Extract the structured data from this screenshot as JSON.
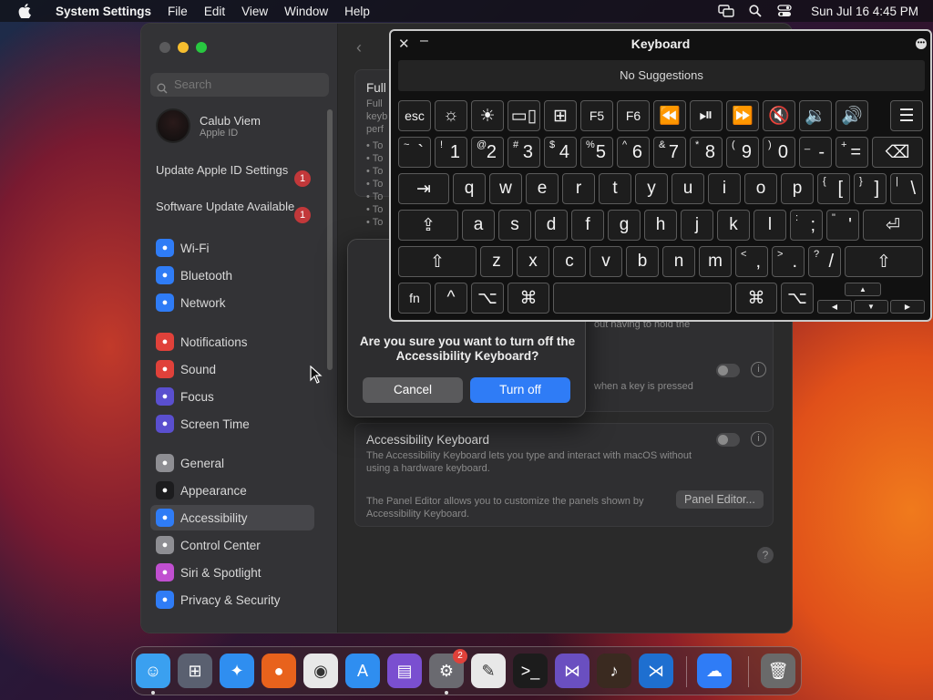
{
  "menubar": {
    "app_name": "System Settings",
    "menus": [
      "File",
      "Edit",
      "View",
      "Window",
      "Help"
    ],
    "status_icons": [
      "screen-mirroring-icon",
      "spotlight-search-icon",
      "control-center-icon"
    ],
    "datetime": "Sun Jul 16  4:45 PM"
  },
  "settings_window": {
    "search_placeholder": "Search",
    "profile": {
      "name": "Calub Viem",
      "subtitle": "Apple ID"
    },
    "notices": [
      {
        "label": "Update Apple ID Settings",
        "badge": "1"
      },
      {
        "label": "Software Update Available",
        "badge": "1"
      }
    ],
    "sidebar_items": [
      {
        "label": "Wi-Fi",
        "icon": "wifi-icon",
        "color": "#2f7cf6"
      },
      {
        "label": "Bluetooth",
        "icon": "bluetooth-icon",
        "color": "#2f7cf6"
      },
      {
        "label": "Network",
        "icon": "globe-icon",
        "color": "#2f7cf6"
      },
      {
        "label": "Notifications",
        "icon": "bell-icon",
        "color": "#e0413a"
      },
      {
        "label": "Sound",
        "icon": "speaker-icon",
        "color": "#e0413a"
      },
      {
        "label": "Focus",
        "icon": "moon-icon",
        "color": "#5a4fcf"
      },
      {
        "label": "Screen Time",
        "icon": "hourglass-icon",
        "color": "#5a4fcf"
      },
      {
        "label": "General",
        "icon": "gear-icon",
        "color": "#8e8e93"
      },
      {
        "label": "Appearance",
        "icon": "appearance-icon",
        "color": "#1c1c1e"
      },
      {
        "label": "Accessibility",
        "icon": "accessibility-icon",
        "color": "#2f7cf6"
      },
      {
        "label": "Control Center",
        "icon": "control-center-icon",
        "color": "#8e8e93"
      },
      {
        "label": "Siri & Spotlight",
        "icon": "siri-icon",
        "color": "#c04fd0"
      },
      {
        "label": "Privacy & Security",
        "icon": "hand-icon",
        "color": "#2f7cf6"
      }
    ],
    "selected_item": "Accessibility",
    "content": {
      "section1_title": "Full",
      "section1_desc": "Full\nkeyb\nperf",
      "section1_bullets": [
        "• To",
        "• To",
        "• To",
        "• To",
        "• To",
        "• To",
        "• To"
      ],
      "partial_text_1": "out having to hold the",
      "partial_text_2": "when a key is pressed",
      "access_kbd_title": "Accessibility Keyboard",
      "access_kbd_desc": "The Accessibility Keyboard lets you type and interact with macOS without using a hardware keyboard.",
      "panel_desc": "The Panel Editor allows you to customize the panels shown by Accessibility Keyboard.",
      "panel_editor_button": "Panel Editor...",
      "help_button": "?"
    }
  },
  "alert": {
    "message": "Are you sure you want to turn off the Accessibility Keyboard?",
    "cancel_label": "Cancel",
    "confirm_label": "Turn off",
    "confirm_color": "#2f7cf6"
  },
  "keyboard_panel": {
    "title": "Keyboard",
    "suggestions": "No Suggestions",
    "rows": [
      [
        {
          "label": "esc"
        },
        {
          "label": "☼",
          "icon": "brightness-down-icon"
        },
        {
          "label": "☀",
          "icon": "brightness-up-icon"
        },
        {
          "label": "▭▯",
          "icon": "mission-control-icon"
        },
        {
          "label": "⊞",
          "icon": "launchpad-icon"
        },
        {
          "label": "F5"
        },
        {
          "label": "F6"
        },
        {
          "label": "⏪",
          "icon": "rewind-icon"
        },
        {
          "label": "⏯",
          "icon": "play-pause-icon"
        },
        {
          "label": "⏩",
          "icon": "fast-forward-icon"
        },
        {
          "label": "🔇",
          "icon": "mute-icon"
        },
        {
          "label": "🔉",
          "icon": "volume-down-icon"
        },
        {
          "label": "🔊",
          "icon": "volume-up-icon"
        },
        {
          "label": "☰",
          "icon": "options-icon"
        }
      ],
      [
        {
          "shift": "~",
          "main": "`"
        },
        {
          "shift": "!",
          "main": "1"
        },
        {
          "shift": "@",
          "main": "2"
        },
        {
          "shift": "#",
          "main": "3"
        },
        {
          "shift": "$",
          "main": "4"
        },
        {
          "shift": "%",
          "main": "5"
        },
        {
          "shift": "^",
          "main": "6"
        },
        {
          "shift": "&",
          "main": "7"
        },
        {
          "shift": "*",
          "main": "8"
        },
        {
          "shift": "(",
          "main": "9"
        },
        {
          "shift": ")",
          "main": "0"
        },
        {
          "shift": "_",
          "main": "-"
        },
        {
          "shift": "+",
          "main": "="
        },
        {
          "label": "⌫",
          "icon": "delete-icon"
        }
      ],
      [
        {
          "label": "⇥",
          "icon": "tab-icon"
        },
        {
          "label": "q"
        },
        {
          "label": "w"
        },
        {
          "label": "e"
        },
        {
          "label": "r"
        },
        {
          "label": "t"
        },
        {
          "label": "y"
        },
        {
          "label": "u"
        },
        {
          "label": "i"
        },
        {
          "label": "o"
        },
        {
          "label": "p"
        },
        {
          "shift": "{",
          "main": "["
        },
        {
          "shift": "}",
          "main": "]"
        },
        {
          "shift": "|",
          "main": "\\"
        }
      ],
      [
        {
          "label": "⇪",
          "icon": "caps-lock-icon"
        },
        {
          "label": "a"
        },
        {
          "label": "s"
        },
        {
          "label": "d"
        },
        {
          "label": "f"
        },
        {
          "label": "g"
        },
        {
          "label": "h"
        },
        {
          "label": "j"
        },
        {
          "label": "k"
        },
        {
          "label": "l"
        },
        {
          "shift": ":",
          "main": ";"
        },
        {
          "shift": "\"",
          "main": "'"
        },
        {
          "label": "⏎",
          "icon": "return-icon"
        }
      ],
      [
        {
          "label": "⇧",
          "icon": "shift-icon"
        },
        {
          "label": "z"
        },
        {
          "label": "x"
        },
        {
          "label": "c"
        },
        {
          "label": "v"
        },
        {
          "label": "b"
        },
        {
          "label": "n"
        },
        {
          "label": "m"
        },
        {
          "shift": "<",
          "main": ","
        },
        {
          "shift": ">",
          "main": "."
        },
        {
          "shift": "?",
          "main": "/"
        },
        {
          "label": "⇧",
          "icon": "shift-icon"
        }
      ],
      [
        {
          "label": "fn"
        },
        {
          "label": "^",
          "icon": "control-icon"
        },
        {
          "label": "⌥",
          "icon": "option-icon"
        },
        {
          "label": "⌘",
          "icon": "command-icon"
        },
        {
          "label": "",
          "icon": "space-bar"
        },
        {
          "label": "⌘",
          "icon": "command-icon"
        },
        {
          "label": "⌥",
          "icon": "option-icon"
        }
      ]
    ],
    "arrows": [
      "▲",
      "◀",
      "▼",
      "▶"
    ]
  },
  "dock": {
    "apps": [
      {
        "name": "Finder",
        "icon": "finder-icon",
        "color": "#3aa0f0",
        "glyph": "☺",
        "running": true
      },
      {
        "name": "Launchpad",
        "icon": "launchpad-icon",
        "color": "#5a6070",
        "glyph": "⊞"
      },
      {
        "name": "Safari",
        "icon": "safari-icon",
        "color": "#2f8ef0",
        "glyph": "✦"
      },
      {
        "name": "Firefox",
        "icon": "firefox-icon",
        "color": "#e8621c",
        "glyph": "●"
      },
      {
        "name": "Chrome",
        "icon": "chrome-icon",
        "color": "#e8e8e8",
        "glyph": "◉"
      },
      {
        "name": "App Store",
        "icon": "app-store-icon",
        "color": "#2f8ef0",
        "glyph": "A"
      },
      {
        "name": "Podcasts",
        "icon": "podcasts-icon",
        "color": "#7a4fd0",
        "glyph": "▤"
      },
      {
        "name": "System Settings",
        "icon": "system-settings-icon",
        "color": "#6a6a70",
        "glyph": "⚙",
        "badge": "2",
        "running": true
      },
      {
        "name": "TextEdit",
        "icon": "textedit-icon",
        "color": "#e8e8e8",
        "glyph": "✎"
      },
      {
        "name": "Terminal",
        "icon": "terminal-icon",
        "color": "#1c1c1c",
        "glyph": ">_"
      },
      {
        "name": "Visual Studio",
        "icon": "visual-studio-icon",
        "color": "#6a4fc0",
        "glyph": "⋈"
      },
      {
        "name": "GarageBand",
        "icon": "garageband-icon",
        "color": "#3a2a20",
        "glyph": "♪"
      },
      {
        "name": "VS Code",
        "icon": "vscode-icon",
        "color": "#1e6fd0",
        "glyph": "⋊"
      },
      {
        "name": "Weather",
        "icon": "weather-icon",
        "color": "#2f7cf6",
        "glyph": "☁"
      },
      {
        "name": "Trash",
        "icon": "trash-icon",
        "color": "#6a6a6a",
        "glyph": "🗑"
      }
    ]
  }
}
